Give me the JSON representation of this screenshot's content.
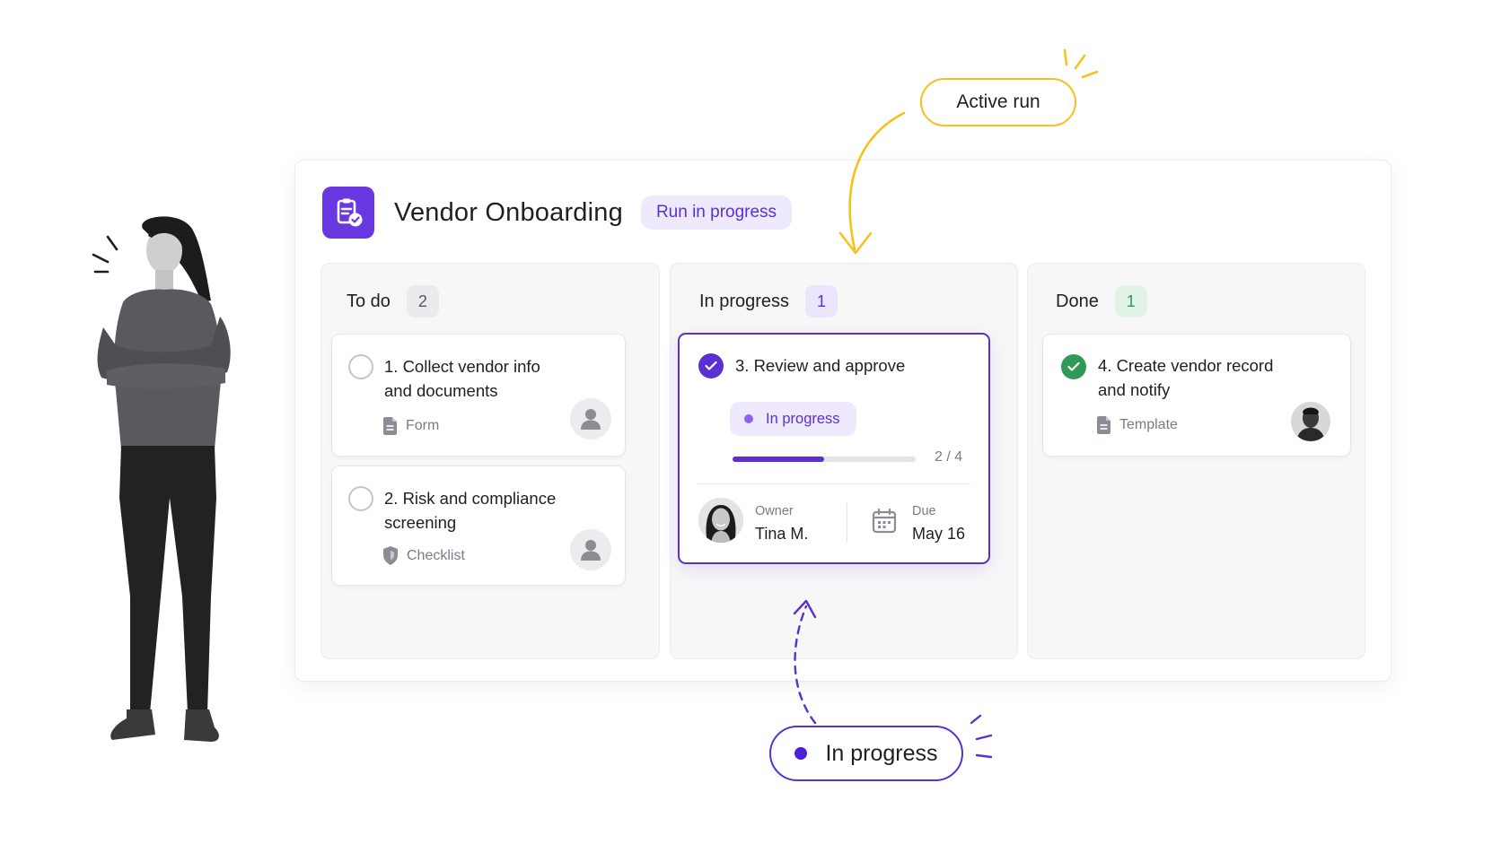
{
  "board": {
    "title": "Vendor Onboarding",
    "status": "Run in progress"
  },
  "columns": {
    "todo": {
      "title": "To do",
      "count": "2"
    },
    "progress": {
      "title": "In progress",
      "count": "1"
    },
    "done": {
      "title": "Done",
      "count": "1"
    }
  },
  "tasks": {
    "t1": {
      "title_line1": "1. Collect vendor info",
      "title_line2": "and documents",
      "type": "Form"
    },
    "t2": {
      "title_line1": "2. Risk and compliance",
      "title_line2": "screening",
      "type": "Checklist"
    },
    "t3": {
      "title": "3. Review and approve",
      "status": "In progress",
      "progress_text": "2 / 4",
      "progress": 0.5,
      "owner_label": "Owner",
      "owner": "Tina M.",
      "due_label": "Due",
      "due": "May 16"
    },
    "t4": {
      "title_line1": "4. Create vendor record",
      "title_line2": "and notify",
      "type": "Template"
    }
  },
  "callouts": {
    "active": "Active run",
    "progress": "In progress"
  },
  "colors": {
    "accent": "#5b2fd1",
    "brand": "#6a38e0",
    "success": "#2f9a58",
    "highlight": "#f5c21b"
  },
  "icons": {
    "app": "clipboard-check-icon",
    "form": "document-icon",
    "checklist": "shield-icon",
    "template": "document-icon",
    "due": "calendar-icon"
  }
}
